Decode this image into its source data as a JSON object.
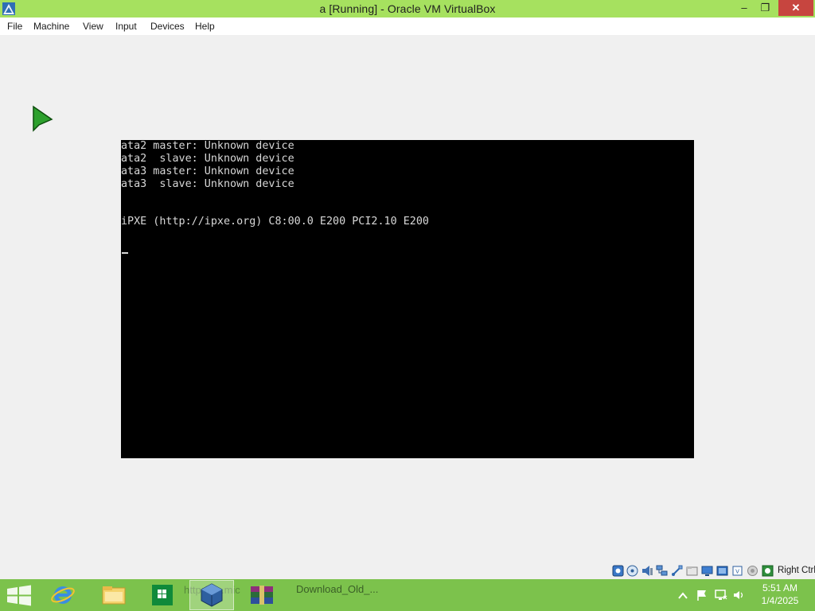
{
  "window": {
    "title": "a [Running] - Oracle VM VirtualBox",
    "controls": {
      "minimize": "–",
      "restore": "❐",
      "close": "✕"
    }
  },
  "menubar": {
    "items": [
      "File",
      "Machine",
      "View",
      "Input",
      "Devices",
      "Help"
    ]
  },
  "console": {
    "lines": [
      "ata2 master: Unknown device",
      "ata2  slave: Unknown device",
      "ata3 master: Unknown device",
      "ata3  slave: Unknown device",
      "",
      "",
      "iPXE (http://ipxe.org) C8:00.0 E200 PCI2.10 E200"
    ]
  },
  "statusbar": {
    "icons": [
      "hard-disk-icon",
      "optical-drive-icon",
      "audio-icon",
      "network-icon",
      "usb-icon",
      "shared-folders-icon",
      "display-icon",
      "video-capture-icon",
      "cpu-icon",
      "recording-icon",
      "mouse-integration-icon",
      "keyboard-capture-icon"
    ],
    "host_key": "Right Ctrl"
  },
  "taskbar": {
    "apps": [
      {
        "name": "internet-explorer",
        "icon": "ie-icon"
      },
      {
        "name": "file-explorer",
        "icon": "folder-icon"
      },
      {
        "name": "store",
        "icon": "store-icon"
      },
      {
        "name": "virtualbox",
        "icon": "virtualbox-icon",
        "active": true
      },
      {
        "name": "winrar",
        "icon": "winrar-icon"
      }
    ],
    "faded_label": "http://go.mic",
    "download_label": "Download_Old_...",
    "tray_icons": [
      "show-hidden-icon",
      "action-center-flag-icon",
      "network-tray-icon",
      "volume-icon"
    ],
    "clock_time": "5:51 AM",
    "clock_date": "1/4/2025"
  },
  "colors": {
    "titlebar": "#a6e15f",
    "taskbar": "#7cc24c",
    "close_button": "#c7453f",
    "console_bg": "#000000",
    "console_fg": "#d8d8d8"
  }
}
